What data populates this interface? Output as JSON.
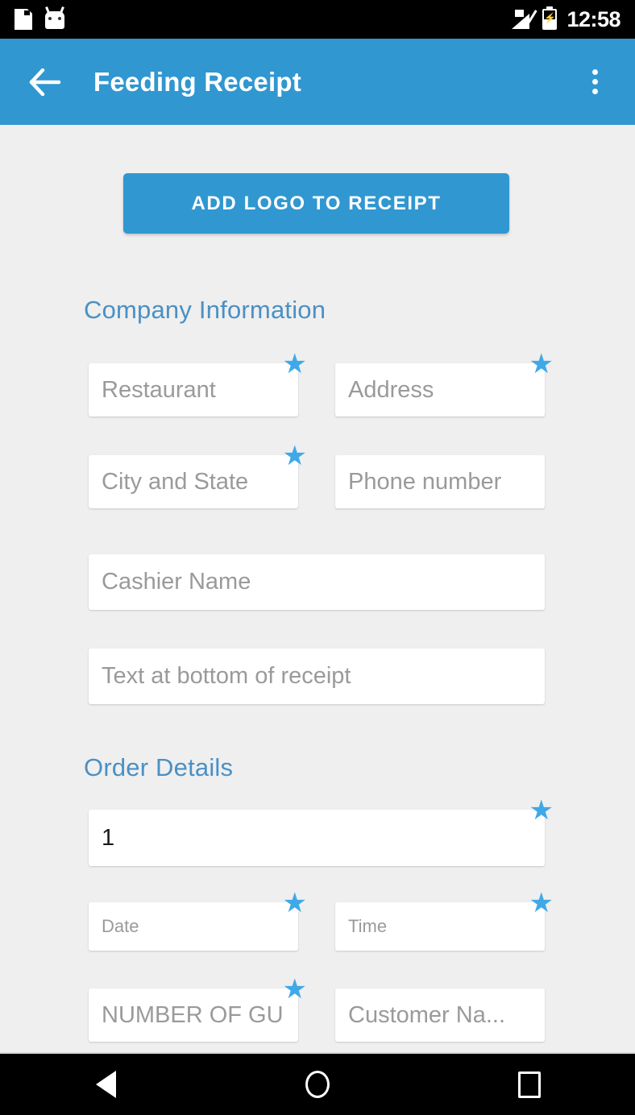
{
  "status_bar": {
    "time": "12:58",
    "left_icons": [
      "sd-card-icon",
      "android-robot-icon"
    ],
    "right_icons": [
      "signal-strength-icon",
      "battery-charging-icon"
    ]
  },
  "app_bar": {
    "back_icon": "back-arrow-icon",
    "title": "Feeding Receipt",
    "overflow_icon": "overflow-menu-icon",
    "background_color": "#3097d1"
  },
  "content": {
    "background_color": "#efefef",
    "add_logo_button": {
      "label": "ADD LOGO TO RECEIPT",
      "color": "#3097d1"
    },
    "sections": [
      {
        "header": "Company Information",
        "header_color": "#4a90c4"
      },
      {
        "header": "Order Details",
        "header_color": "#4a90c4"
      }
    ],
    "required_marker": "★",
    "required_marker_color": "#3fa9e8",
    "fields": {
      "restaurant": {
        "placeholder": "Restaurant",
        "value": "",
        "required": true
      },
      "address": {
        "placeholder": "Address",
        "value": "",
        "required": true
      },
      "city_state": {
        "placeholder": "City and State",
        "value": "",
        "required": true
      },
      "phone": {
        "placeholder": "Phone number",
        "value": "",
        "required": false
      },
      "cashier_name": {
        "placeholder": "Cashier Name",
        "value": "",
        "required": false
      },
      "bottom_text": {
        "placeholder": "Text at bottom of receipt",
        "value": "",
        "required": false
      },
      "order_number": {
        "placeholder": "",
        "value": "1",
        "required": true
      },
      "date": {
        "placeholder": "Date",
        "value": "",
        "required": true
      },
      "time": {
        "placeholder": "Time",
        "value": "",
        "required": true
      },
      "guests": {
        "placeholder": "NUMBER OF GU",
        "value": "",
        "required": true
      },
      "customer": {
        "placeholder": "Customer Na...",
        "value": "",
        "required": false
      }
    }
  },
  "nav_bar": {
    "back_icon": "nav-back-icon",
    "home_icon": "nav-home-icon",
    "recents_icon": "nav-recents-icon"
  }
}
